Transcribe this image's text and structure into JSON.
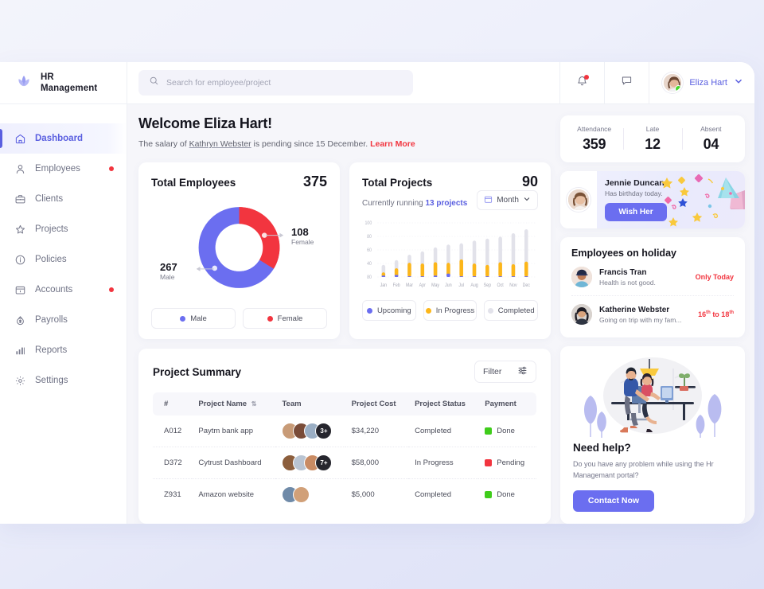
{
  "brand": {
    "line1": "HR",
    "line2": "Management",
    "logo_icon": "lotus-logo-icon"
  },
  "sidebar": {
    "items": [
      {
        "label": "Dashboard",
        "icon": "home-icon",
        "active": true,
        "dot": false
      },
      {
        "label": "Employees",
        "icon": "user-icon",
        "active": false,
        "dot": true
      },
      {
        "label": "Clients",
        "icon": "briefcase-icon",
        "active": false,
        "dot": false
      },
      {
        "label": "Projects",
        "icon": "star-icon",
        "active": false,
        "dot": false
      },
      {
        "label": "Policies",
        "icon": "info-circle-icon",
        "active": false,
        "dot": false
      },
      {
        "label": "Accounts",
        "icon": "calendar-icon",
        "active": false,
        "dot": true
      },
      {
        "label": "Payrolls",
        "icon": "money-icon",
        "active": false,
        "dot": false
      },
      {
        "label": "Reports",
        "icon": "bar-chart-icon",
        "active": false,
        "dot": false
      },
      {
        "label": "Settings",
        "icon": "gear-icon",
        "active": false,
        "dot": false
      }
    ]
  },
  "topbar": {
    "search_placeholder": "Search for employee/project",
    "search_value": "",
    "search_icon": "search-icon",
    "notification_icon": "bell-icon",
    "message_icon": "chat-icon",
    "user_name": "Eliza Hart",
    "chevron_icon": "chevron-down-icon"
  },
  "welcome": {
    "title": "Welcome Eliza Hart!",
    "sub_prefix": "The salary of ",
    "sub_link": "Kathryn Webster",
    "sub_middle": " is pending since 15 December. ",
    "sub_action": "Learn More"
  },
  "stats": [
    {
      "caption": "Attendance",
      "value": "359"
    },
    {
      "caption": "Late",
      "value": "12"
    },
    {
      "caption": "Absent",
      "value": "04"
    }
  ],
  "employees_card": {
    "title": "Total Employees",
    "total": "375",
    "male_value": "267",
    "male_caption": "Male",
    "female_value": "108",
    "female_caption": "Female",
    "legend": [
      {
        "label": "Male",
        "color": "#6b6ef0"
      },
      {
        "label": "Female",
        "color": "#f2353f"
      }
    ]
  },
  "projects_card": {
    "title": "Total Projects",
    "total": "90",
    "running_prefix": "Currently running ",
    "running_count": "13 projects",
    "period_label": "Month",
    "period_icon": "calendar-icon",
    "chevron_icon": "chevron-down-icon",
    "legend": [
      {
        "label": "Upcoming",
        "color": "#6b6ef0"
      },
      {
        "label": "In Progress",
        "color": "#fcb61a"
      },
      {
        "label": "Completed",
        "color": "#e2e2ea"
      }
    ]
  },
  "chart_data": [
    {
      "type": "pie",
      "title": "Total Employees",
      "labels": [
        "Male",
        "Female"
      ],
      "values": [
        267,
        108
      ],
      "colors": [
        "#6b6ef0",
        "#f2353f"
      ],
      "total": 375,
      "donut": true,
      "annotations": [
        "267 Male",
        "108 Female"
      ],
      "legend_position": "bottom"
    },
    {
      "type": "bar",
      "title": "Total Projects",
      "subtitle": "Currently running 13 projects",
      "categories": [
        "Jan",
        "Feb",
        "Mar",
        "Apr",
        "May",
        "Jun",
        "Jul",
        "Aug",
        "Sep",
        "Oct",
        "Nov",
        "Dec"
      ],
      "series": [
        {
          "name": "Upcoming",
          "color": "#6b6ef0",
          "values": [
            22,
            23,
            21,
            21,
            22,
            25,
            21,
            21,
            21,
            21,
            21,
            21
          ]
        },
        {
          "name": "In Progress",
          "color": "#fcb61a",
          "values": [
            27,
            33,
            41,
            40,
            42,
            41,
            46,
            40,
            38,
            42,
            39,
            43
          ]
        },
        {
          "name": "Completed",
          "color": "#e2e2ea",
          "values": [
            38,
            45,
            53,
            58,
            64,
            68,
            70,
            74,
            77,
            80,
            85,
            91
          ]
        }
      ],
      "stacked": true,
      "ylim": [
        20,
        100
      ],
      "yticks": [
        20,
        40,
        60,
        80,
        100
      ],
      "grid": true,
      "legend_position": "bottom",
      "total": 90
    }
  ],
  "birthday": {
    "name": "Jennie Duncan",
    "note": "Has birthday today.",
    "button": "Wish Her",
    "avatar_icon": "avatar"
  },
  "holiday": {
    "title": "Employees on holiday",
    "rows": [
      {
        "name": "Francis Tran",
        "note": "Health is not good.",
        "when": "Only Today",
        "when_sup": ""
      },
      {
        "name": "Katherine Webster",
        "note": "Going on trip with my fam...",
        "when": "16|th| to 18|th|",
        "when_sup": "th"
      }
    ]
  },
  "summary": {
    "title": "Project Summary",
    "filter_label": "Filter",
    "filter_icon": "sliders-icon",
    "sort_icon": "sort-icon",
    "columns": [
      "#",
      "Project Name",
      "Team",
      "Project Cost",
      "Project Status",
      "Payment"
    ],
    "rows": [
      {
        "id": "A012",
        "name": "Paytm bank app",
        "team_more": "3+",
        "team_count": 3,
        "cost": "$34,220",
        "status": "Completed",
        "payment": "Done",
        "payment_color": "#3fcc1b"
      },
      {
        "id": "D372",
        "name": "Cytrust Dashboard",
        "team_more": "7+",
        "team_count": 3,
        "cost": "$58,000",
        "status": "In Progress",
        "payment": "Pending",
        "payment_color": "#f2353f"
      },
      {
        "id": "Z931",
        "name": "Amazon website",
        "team_more": "",
        "team_count": 2,
        "cost": "$5,000",
        "status": "Completed",
        "payment": "Done",
        "payment_color": "#3fcc1b"
      }
    ]
  },
  "help": {
    "title": "Need help?",
    "text": "Do you have any problem while using the Hr Managemant portal?",
    "button": "Contact Now",
    "illustration_icon": "support-illustration"
  },
  "colors": {
    "accent": "#6b6ef0",
    "danger": "#f2353f",
    "warning": "#fcb61a",
    "success": "#3fcc1b",
    "muted": "#e2e2ea"
  }
}
